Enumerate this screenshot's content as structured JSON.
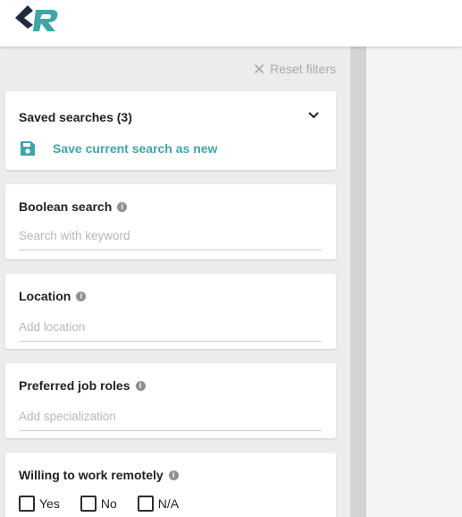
{
  "header": {
    "logo": "logo-mark"
  },
  "filters": {
    "reset_label": "Reset filters",
    "saved_searches": {
      "title": "Saved searches (3)",
      "save_current_label": "Save current search as new"
    },
    "boolean_search": {
      "title": "Boolean search",
      "placeholder": "Search with keyword",
      "value": ""
    },
    "location": {
      "title": "Location",
      "placeholder": "Add location",
      "value": ""
    },
    "preferred_job_roles": {
      "title": "Preferred job roles",
      "placeholder": "Add specialization",
      "value": ""
    },
    "willing_remote": {
      "title": "Willing to work remotely",
      "options": [
        {
          "label": "Yes",
          "checked": false
        },
        {
          "label": "No",
          "checked": false
        },
        {
          "label": "N/A",
          "checked": false
        }
      ]
    }
  },
  "colors": {
    "accent": "#3fa5a8",
    "logo_dark": "#1f2a3c",
    "logo_teal": "#3fa5a8",
    "panel_bg": "#ececec"
  }
}
